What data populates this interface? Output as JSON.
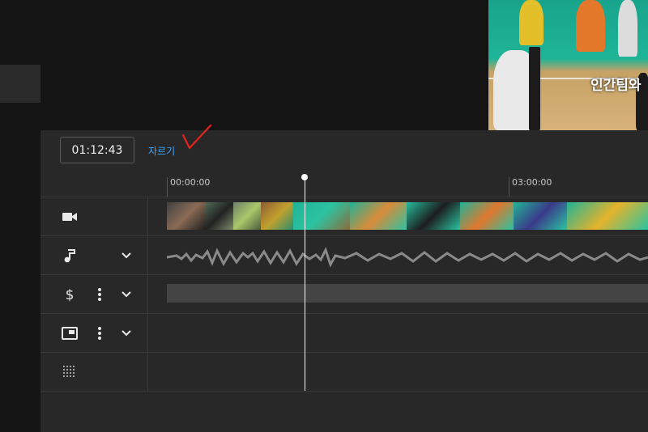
{
  "preview": {
    "caption": "인간팀와"
  },
  "editor": {
    "current_time": "01:12:43",
    "trim_label": "자르기",
    "ruler_labels": [
      "00:00:00",
      "03:00:00"
    ]
  },
  "tracks": [
    {
      "name": "video",
      "icon": "video-camera-icon"
    },
    {
      "name": "audio",
      "icon": "music-note-icon"
    },
    {
      "name": "monetization",
      "icon": "dollar-icon"
    },
    {
      "name": "end-screen",
      "icon": "end-screen-icon"
    },
    {
      "name": "blur",
      "icon": "blur-grid-icon"
    }
  ],
  "colors": {
    "accent": "#3ea6ff",
    "annotation": "#e0251b",
    "playhead": "#ffffff"
  }
}
